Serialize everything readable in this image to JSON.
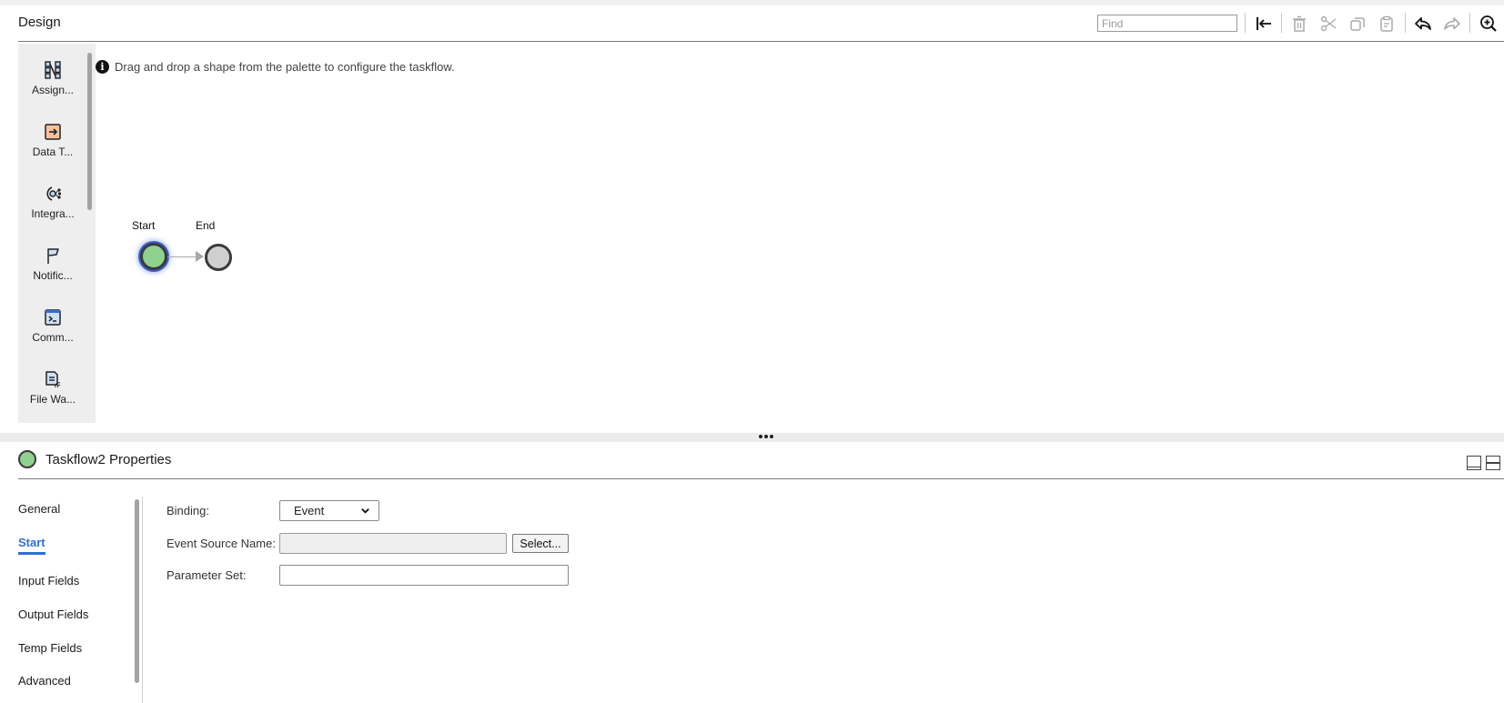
{
  "design": {
    "title": "Design",
    "find_placeholder": "Find",
    "toolbar": [
      {
        "name": "collapse-left-icon",
        "label": "Collapse palette",
        "enabled": true
      },
      {
        "name": "delete-icon",
        "label": "Delete",
        "enabled": false
      },
      {
        "name": "cut-icon",
        "label": "Cut",
        "enabled": false
      },
      {
        "name": "copy-icon",
        "label": "Copy",
        "enabled": false
      },
      {
        "name": "paste-icon",
        "label": "Paste",
        "enabled": false
      },
      {
        "name": "undo-icon",
        "label": "Undo",
        "enabled": true
      },
      {
        "name": "redo-icon",
        "label": "Redo",
        "enabled": false
      },
      {
        "name": "zoom-in-icon",
        "label": "Zoom in",
        "enabled": true
      }
    ]
  },
  "palette": {
    "items": [
      {
        "label": "Assign...",
        "icon": "assignment-icon"
      },
      {
        "label": "Data T...",
        "icon": "data-task-icon"
      },
      {
        "label": "Integra...",
        "icon": "integration-icon"
      },
      {
        "label": "Notific...",
        "icon": "notification-flag-icon"
      },
      {
        "label": "Comm...",
        "icon": "command-terminal-icon"
      },
      {
        "label": "File Wa...",
        "icon": "file-watch-icon"
      }
    ]
  },
  "canvas": {
    "info_text": "Drag and drop a shape from the palette to configure the taskflow.",
    "nodes": [
      {
        "label": "Start",
        "type": "start",
        "selected": true
      },
      {
        "label": "End",
        "type": "end",
        "selected": false
      }
    ],
    "colors": {
      "start_fill": "#8fd18f",
      "end_fill": "#cfcfcf",
      "selection": "#3a5fd0"
    }
  },
  "properties": {
    "title": "Taskflow2 Properties",
    "nav": [
      {
        "label": "General",
        "active": false
      },
      {
        "label": "Start",
        "active": true
      },
      {
        "label": "Input Fields",
        "active": false
      },
      {
        "label": "Output Fields",
        "active": false
      },
      {
        "label": "Temp Fields",
        "active": false
      },
      {
        "label": "Advanced",
        "active": false
      }
    ],
    "accent": "#2f6fd6",
    "form": {
      "binding_label": "Binding:",
      "binding_value": "Event",
      "event_source_label": "Event Source Name:",
      "event_source_value": "",
      "select_button": "Select...",
      "parameter_set_label": "Parameter Set:",
      "parameter_set_value": ""
    }
  }
}
